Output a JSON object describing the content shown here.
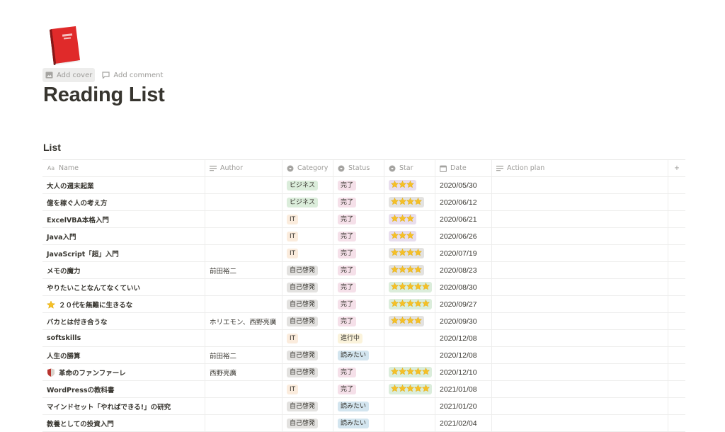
{
  "page": {
    "title": "Reading List",
    "icon": "red-book-icon",
    "add_cover": "Add cover",
    "add_comment": "Add comment"
  },
  "database": {
    "title": "List",
    "columns": {
      "name": "Name",
      "author": "Author",
      "category": "Category",
      "status": "Status",
      "star": "Star",
      "date": "Date",
      "action": "Action plan",
      "add": "+"
    },
    "colors": {
      "ビジネス": "#dbeddb",
      "IT": "#fbecdd",
      "自己啓発": "#e3e2e0",
      "完了": "#f5e0e9",
      "進行中": "#fbf3db",
      "読みたい": "#d3e5ef",
      "star3": "#e8deee",
      "star4": "#e3e2e0",
      "star5": "#dbeddb"
    },
    "rows": [
      {
        "name": "大人の週末起業",
        "author": "",
        "category": "ビジネス",
        "status": "完了",
        "stars": 3,
        "date": "2020/05/30",
        "action": ""
      },
      {
        "name": "億を稼ぐ人の考え方",
        "author": "",
        "category": "ビジネス",
        "status": "完了",
        "stars": 4,
        "date": "2020/06/12",
        "action": ""
      },
      {
        "name": "ExcelVBA本格入門",
        "author": "",
        "category": "IT",
        "status": "完了",
        "stars": 3,
        "date": "2020/06/21",
        "action": ""
      },
      {
        "name": "Java入門",
        "author": "",
        "category": "IT",
        "status": "完了",
        "stars": 3,
        "date": "2020/06/26",
        "action": ""
      },
      {
        "name": "JavaScript「超」入門",
        "author": "",
        "category": "IT",
        "status": "完了",
        "stars": 4,
        "date": "2020/07/19",
        "action": ""
      },
      {
        "name": "メモの魔力",
        "author": "前田裕二",
        "category": "自己啓発",
        "status": "完了",
        "stars": 4,
        "date": "2020/08/23",
        "action": ""
      },
      {
        "name": "やりたいことなんてなくていい",
        "author": "",
        "category": "自己啓発",
        "status": "完了",
        "stars": 5,
        "date": "2020/08/30",
        "action": ""
      },
      {
        "name": "２０代を無難に生きるな",
        "icon": "star-icon",
        "author": "",
        "category": "自己啓発",
        "status": "完了",
        "stars": 5,
        "date": "2020/09/27",
        "action": ""
      },
      {
        "name": "バカとは付き合うな",
        "author": "ホリエモン、西野亮廣",
        "category": "自己啓発",
        "status": "完了",
        "stars": 4,
        "date": "2020/09/30",
        "action": ""
      },
      {
        "name": "softskills",
        "author": "",
        "category": "IT",
        "status": "進行中",
        "stars": 0,
        "date": "2020/12/08",
        "action": ""
      },
      {
        "name": "人生の勝算",
        "author": "前田裕二",
        "category": "自己啓発",
        "status": "読みたい",
        "stars": 0,
        "date": "2020/12/08",
        "action": ""
      },
      {
        "name": "革命のファンファーレ",
        "icon": "shield-icon",
        "author": "西野亮廣",
        "category": "自己啓発",
        "status": "完了",
        "stars": 5,
        "date": "2020/12/10",
        "action": ""
      },
      {
        "name": "WordPressの教科書",
        "author": "",
        "category": "IT",
        "status": "完了",
        "stars": 5,
        "date": "2021/01/08",
        "action": ""
      },
      {
        "name": "マインドセット「やればできる!」の研究",
        "author": "",
        "category": "自己啓発",
        "status": "読みたい",
        "stars": 0,
        "date": "2021/01/20",
        "action": ""
      },
      {
        "name": "教養としての投資入門",
        "author": "",
        "category": "自己啓発",
        "status": "読みたい",
        "stars": 0,
        "date": "2021/02/04",
        "action": ""
      }
    ]
  }
}
